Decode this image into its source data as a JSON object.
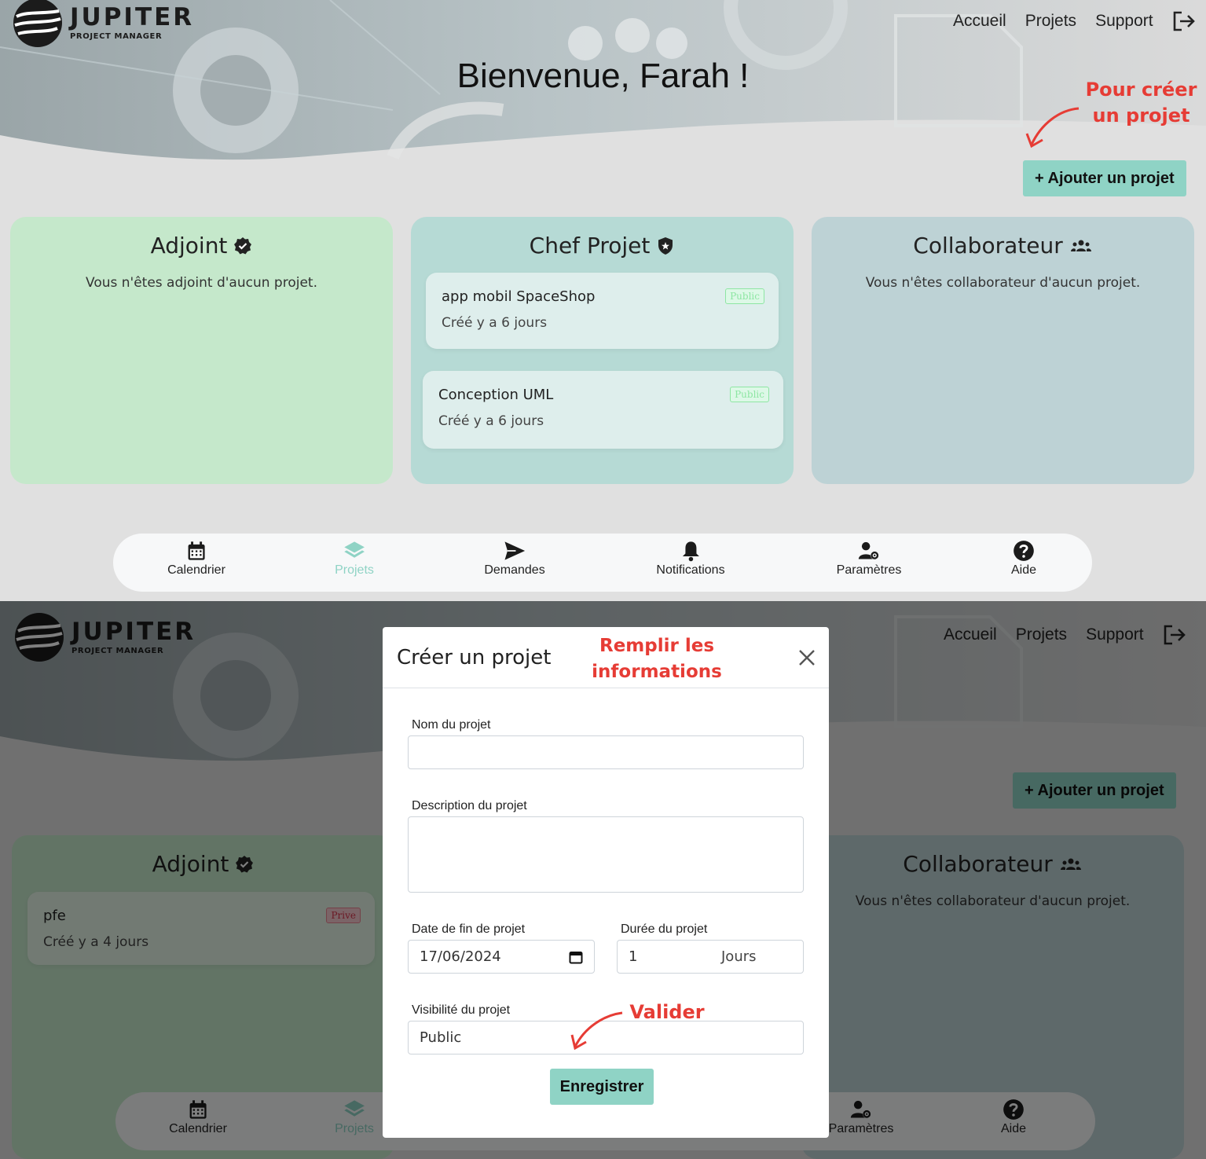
{
  "brand": {
    "title": "JUPITER",
    "subtitle": "PROJECT MANAGER"
  },
  "topnav": {
    "home": "Accueil",
    "projects": "Projets",
    "support": "Support",
    "logout_icon": "logout-icon"
  },
  "screen1": {
    "welcome": "Bienvenue, Farah !",
    "annotation_create": "Pour créer un projet",
    "add_button": "+ Ajouter un projet",
    "panels": {
      "adjoint": {
        "title": "Adjoint",
        "icon": "verified-badge-icon",
        "empty": "Vous n'êtes adjoint d'aucun projet.",
        "bg": "#c5e8cb"
      },
      "chef": {
        "title": "Chef Projet",
        "icon": "shield-icon",
        "bg": "#b6dad5",
        "projects": [
          {
            "name": "app mobil SpaceShop",
            "created": "Créé y a 6 jours",
            "visibility": "Public"
          },
          {
            "name": "Conception UML",
            "created": "Créé y a 6 jours",
            "visibility": "Public"
          }
        ]
      },
      "collab": {
        "title": "Collaborateur",
        "icon": "users-icon",
        "empty": "Vous n'êtes collaborateur d'aucun projet.",
        "bg": "#bdd2d5"
      }
    }
  },
  "bottomnav": {
    "items": [
      {
        "label": "Calendrier",
        "icon": "calendar-icon"
      },
      {
        "label": "Projets",
        "icon": "layers-icon",
        "active": true
      },
      {
        "label": "Demandes",
        "icon": "send-icon"
      },
      {
        "label": "Notifications",
        "icon": "bell-icon"
      },
      {
        "label": "Paramètres",
        "icon": "user-settings-icon"
      },
      {
        "label": "Aide",
        "icon": "help-icon"
      }
    ]
  },
  "screen2": {
    "add_button": "+ Ajouter un projet",
    "adjoint_title": "Adjoint",
    "adjoint_project": {
      "name": "pfe",
      "created": "Créé y a 4 jours",
      "visibility": "Prive"
    },
    "collab_title": "Collaborateur",
    "collab_empty": "Vous n'êtes collaborateur d'aucun projet.",
    "modal": {
      "title": "Créer un projet",
      "annotation_fill": "Remplir les informations",
      "name_label": "Nom du projet",
      "name_value": "",
      "description_label": "Description du projet",
      "description_value": "",
      "end_date_label": "Date de fin de projet",
      "end_date_value": "17/06/2024",
      "duration_label": "Durée du projet",
      "duration_value": "1",
      "duration_unit": "Jours",
      "visibility_label": "Visibilité du projet",
      "visibility_value": "Public",
      "annotation_validate": "Valider",
      "save_button": "Enregistrer"
    }
  },
  "colors": {
    "accent": "#8fd3c5",
    "annotation": "#e63c35",
    "active_nav": "#8fd3c5"
  }
}
